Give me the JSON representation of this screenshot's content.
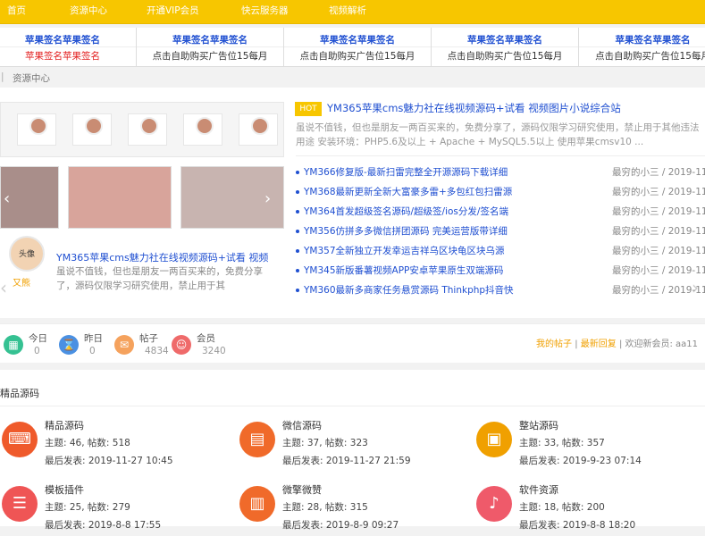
{
  "topnav": [
    "首页",
    "资源中心",
    "开通VIP会员",
    "快云服务器",
    "视频解析"
  ],
  "ads": [
    {
      "top": "苹果签名苹果签名",
      "bottom": "苹果签名苹果签名",
      "bottom_red": true
    },
    {
      "top": "苹果签名苹果签名",
      "bottom": "点击自助购买广告位15每月",
      "bottom_red": false
    },
    {
      "top": "苹果签名苹果签名",
      "bottom": "点击自助购买广告位15每月",
      "bottom_red": false
    },
    {
      "top": "苹果签名苹果签名",
      "bottom": "点击自助购买广告位15每月",
      "bottom_red": false
    },
    {
      "top": "苹果签名苹果签名",
      "bottom": "点击自助购买广告位15每月",
      "bottom_red": false
    }
  ],
  "breadcrumb": {
    "sep": "|",
    "label": "资源中心"
  },
  "slide": {
    "title": "YM365苹果cms魅力社在线视频源码+试看 视频",
    "desc": "虽说不值钱，但也是朋友一两百买来的，免费分享了，源码仅限学习研究使用，禁止用于其",
    "avatar_name": "又熊",
    "avatar_label": "头像"
  },
  "hot": {
    "badge": "HOT",
    "title": "YM365苹果cms魅力社在线视频源码+试看 视频图片小说综合站",
    "summary": "虽说不值钱，但也是朋友一两百买来的，免费分享了，源码仅限学习研究使用，禁止用于其他违法用途 安装环境：PHP5.6及以上 + Apache + MySQL5.5以上 使用苹果cmsv10 ..."
  },
  "news": [
    {
      "title": "YM366修复版-最新扫雷完整全开源源码下载详细",
      "meta": "最穷的小三 / 2019-11-"
    },
    {
      "title": "YM368最新更新全新大富豪多雷+多包红包扫雷源",
      "meta": "最穷的小三 / 2019-11-"
    },
    {
      "title": "YM364首发超级签名源码/超级签/ios分发/签名端",
      "meta": "最穷的小三 / 2019-11-"
    },
    {
      "title": "YM356仿拼多多微信拼团源码 完美运营版带详细",
      "meta": "最穷的小三 / 2019-11-"
    },
    {
      "title": "YM357全新独立开发幸运吉祥乌区块龟区块乌源",
      "meta": "最穷的小三 / 2019-11-"
    },
    {
      "title": "YM345新版番薯视频APP安卓苹果原生双端源码",
      "meta": "最穷的小三 / 2019-11-"
    },
    {
      "title": "YM360最新多商家任务悬赏源码 Thinkphp抖音快",
      "meta": "最穷的小三 / 2019-11-"
    }
  ],
  "stats": [
    {
      "label": "今日",
      "value": "0",
      "color": "#35c192",
      "icon": "calendar-icon"
    },
    {
      "label": "昨日",
      "value": "0",
      "color": "#4a90e2",
      "icon": "hourglass-icon"
    },
    {
      "label": "帖子",
      "value": "4834",
      "color": "#f5a25d",
      "icon": "post-icon"
    },
    {
      "label": "会员",
      "value": "3240",
      "color": "#ef6a6a",
      "icon": "user-icon"
    }
  ],
  "statlinks": {
    "my_posts": "我的帖子",
    "sep": "|",
    "latest_replies": "最新回复",
    "welcome": "| 欢迎新会员: aa11"
  },
  "forum": {
    "header": "精品源码",
    "labels": {
      "topics": "主题",
      "posts": "帖数",
      "last": "最后发表"
    },
    "boards": [
      {
        "name": "精品源码",
        "topics": "主题: 46, 帖数: 518",
        "last": "最后发表: 2019-11-27 10:45",
        "color": "#ef5a2b",
        "icon": "code-icon"
      },
      {
        "name": "微信源码",
        "topics": "主题: 37, 帖数: 323",
        "last": "最后发表: 2019-11-27 21:59",
        "color": "#f06a2a",
        "icon": "wechat-icon"
      },
      {
        "name": "整站源码",
        "topics": "主题: 33, 帖数: 357",
        "last": "最后发表: 2019-9-23 07:14",
        "color": "#f0a000",
        "icon": "site-icon"
      },
      {
        "name": "模板插件",
        "topics": "主题: 25, 帖数: 279",
        "last": "最后发表: 2019-8-8 17:55",
        "color": "#ef5555",
        "icon": "template-icon"
      },
      {
        "name": "微擎微赞",
        "topics": "主题: 28, 帖数: 315",
        "last": "最后发表: 2019-8-9 09:27",
        "color": "#f06a2a",
        "icon": "weiqing-icon"
      },
      {
        "name": "软件资源",
        "topics": "主题: 18, 帖数: 200",
        "last": "最后发表: 2019-8-8 18:20",
        "color": "#ef5a6a",
        "icon": "software-icon"
      }
    ]
  }
}
